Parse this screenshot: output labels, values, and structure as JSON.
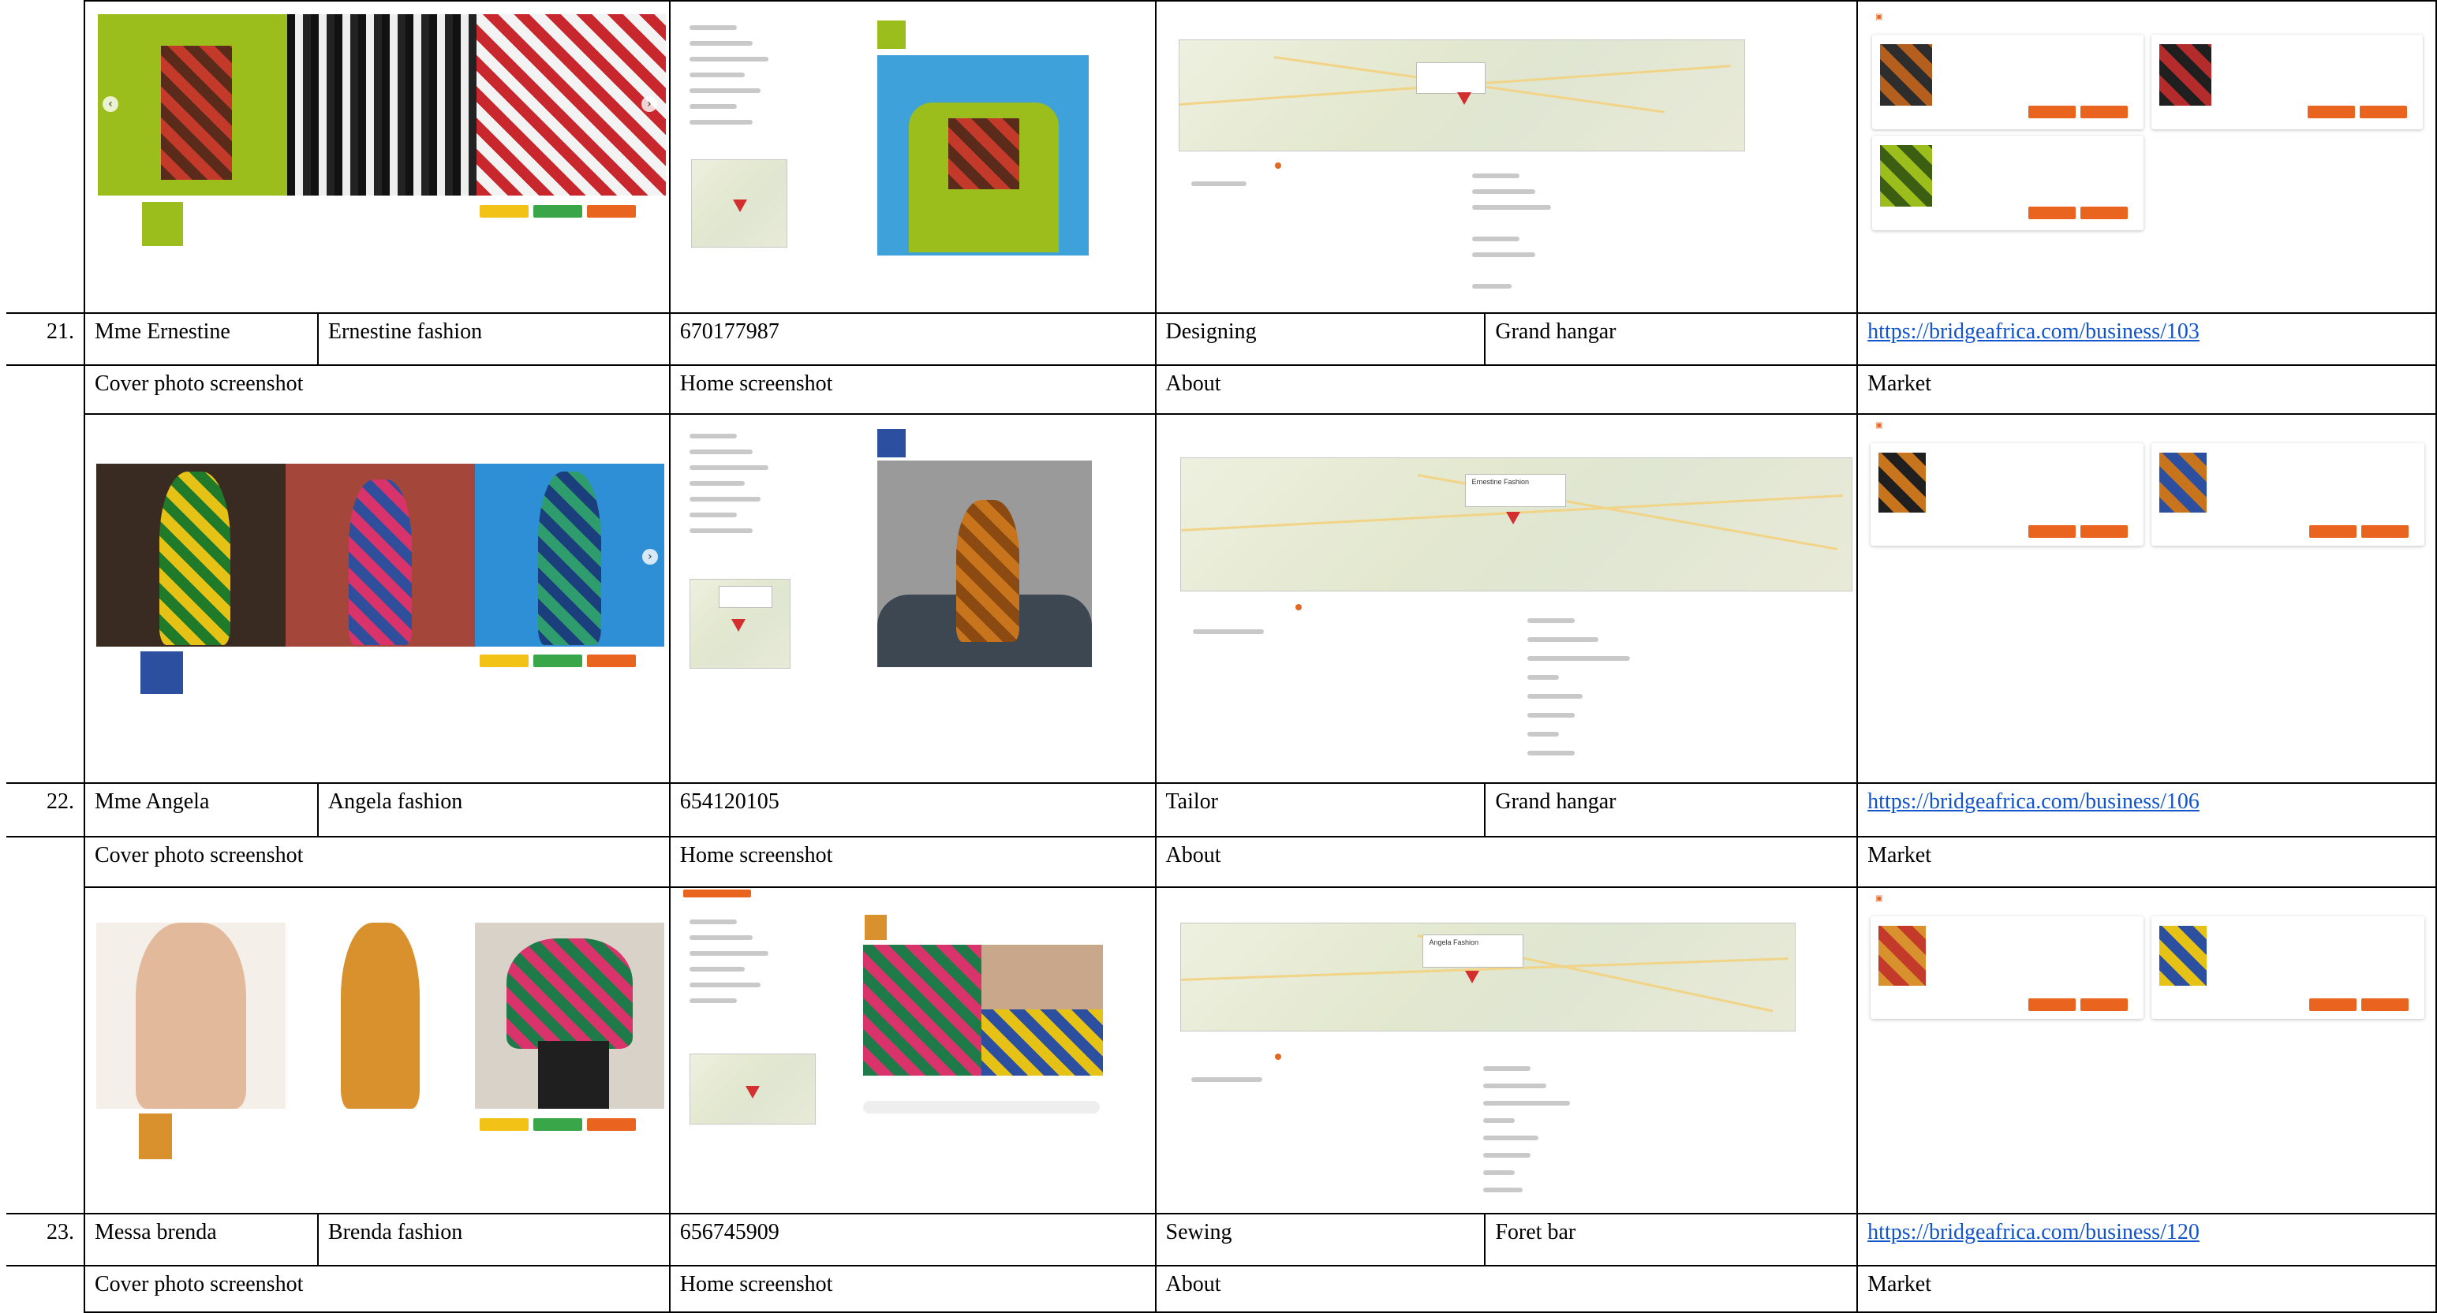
{
  "rows": [
    {
      "number": "21.",
      "name": "Mme Ernestine",
      "business": "Ernestine fashion",
      "phone": "670177987",
      "activity": "Designing",
      "location": "Grand hangar",
      "link": "https://bridgeafrica.com/business/103",
      "map_label": "Ernestine Fashion"
    },
    {
      "number": "22.",
      "name": "Mme Angela",
      "business": "Angela fashion",
      "phone": "654120105",
      "activity": "Tailor",
      "location": "Grand hangar",
      "link": "https://bridgeafrica.com/business/106",
      "map_label": "Angela Fashion"
    },
    {
      "number": "23.",
      "name": "Messa brenda",
      "business": "Brenda fashion",
      "phone": "656745909",
      "activity": "Sewing",
      "location": "Foret bar",
      "link": "https://bridgeafrica.com/business/120"
    }
  ],
  "labels": {
    "cover": "Cover photo screenshot",
    "home": "Home screenshot",
    "about": "About",
    "market": "Market"
  },
  "colors": {
    "accent_orange": "#e8641f",
    "link_blue": "#1155cc",
    "map_pin": "#d32f2f"
  }
}
